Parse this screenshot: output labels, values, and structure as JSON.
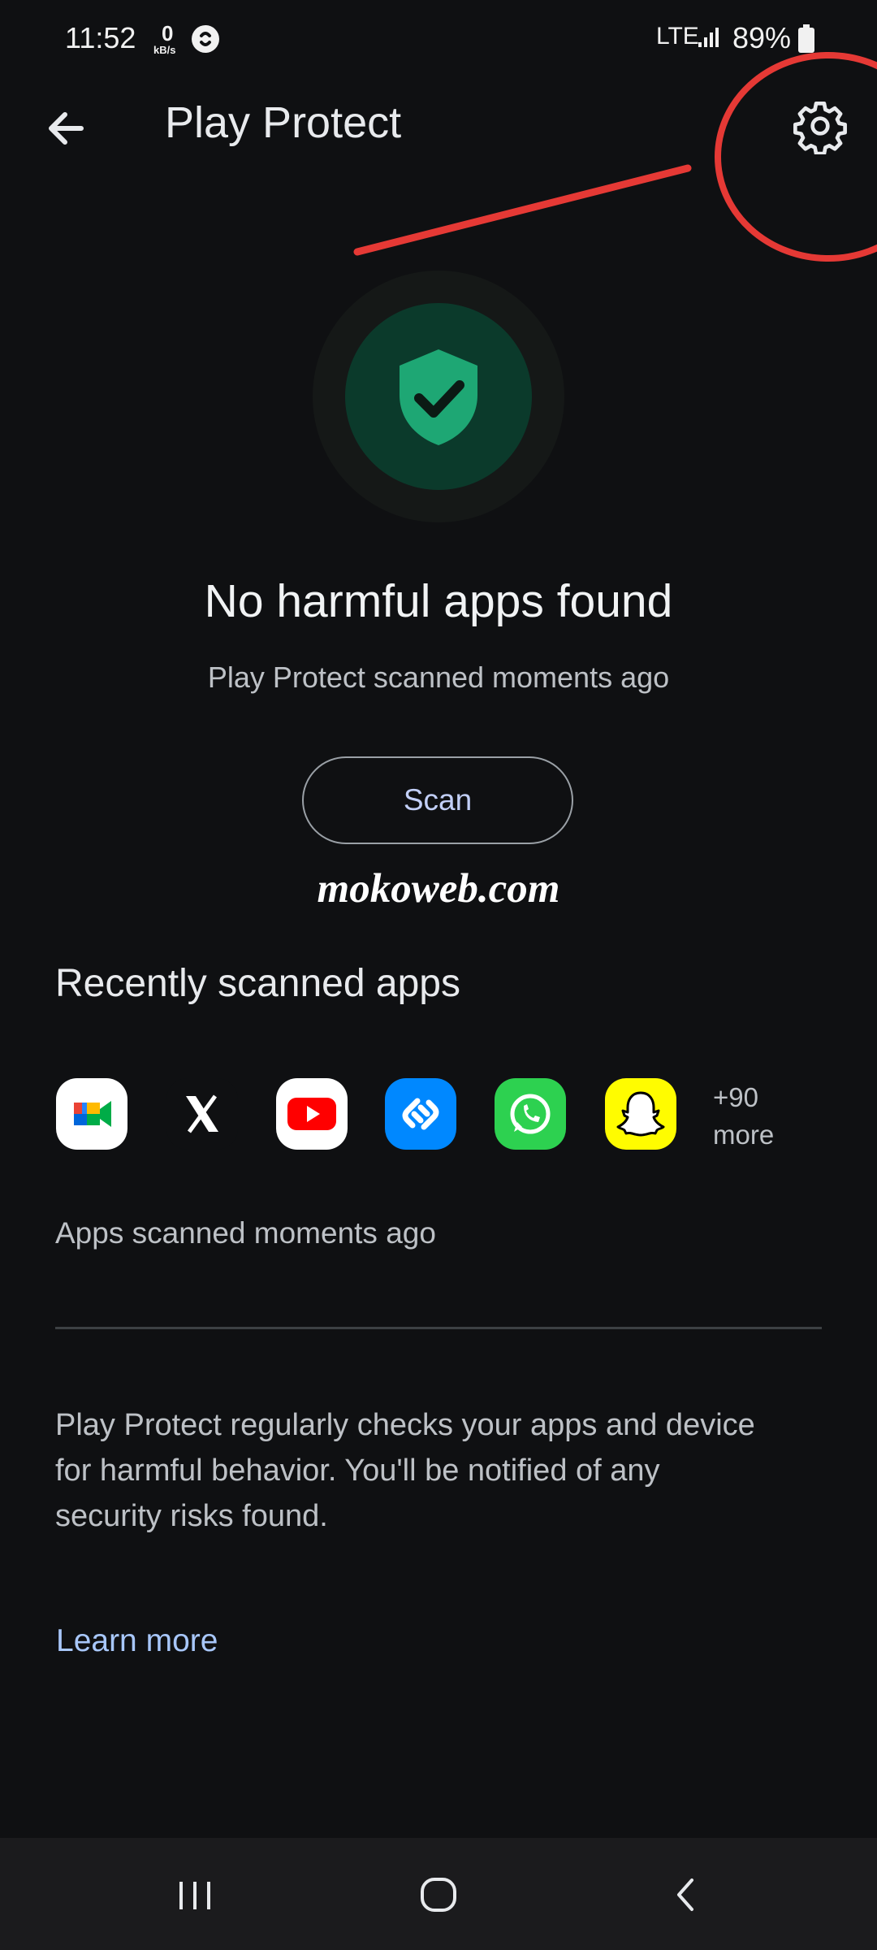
{
  "status_bar": {
    "time": "11:52",
    "net_speed_value": "0",
    "net_speed_unit": "kB/s",
    "network": "LTE",
    "battery": "89%"
  },
  "app_bar": {
    "title": "Play Protect",
    "back_icon": "arrow-back-icon",
    "settings_icon": "gear-icon"
  },
  "status": {
    "headline": "No harmful apps found",
    "subtext": "Play Protect scanned moments ago",
    "scan_button": "Scan",
    "shield_icon": "shield-check-icon"
  },
  "watermark": "mokoweb.com",
  "recent": {
    "title": "Recently scanned apps",
    "apps": [
      {
        "name": "Google Meet",
        "icon": "google-meet-icon"
      },
      {
        "name": "X",
        "icon": "x-icon"
      },
      {
        "name": "YouTube",
        "icon": "youtube-icon"
      },
      {
        "name": "Shazam",
        "icon": "shazam-icon"
      },
      {
        "name": "WhatsApp",
        "icon": "whatsapp-icon"
      },
      {
        "name": "Snapchat",
        "icon": "snapchat-icon"
      }
    ],
    "more_count": "+90",
    "more_label": "more",
    "scanned_text": "Apps scanned moments ago"
  },
  "info": {
    "line1": "Play Protect regularly checks your apps and device",
    "line2": "for harmful behavior. You'll be notified of any",
    "line3": "security risks found.",
    "learn_more": "Learn more"
  },
  "nav_bar": {
    "recents_icon": "recent-apps-icon",
    "home_icon": "home-icon",
    "back_icon": "nav-back-icon"
  },
  "colors": {
    "background": "#0f1012",
    "accent": "#a8c7fa",
    "shield": "#1ea774",
    "annotation": "#e53935"
  }
}
